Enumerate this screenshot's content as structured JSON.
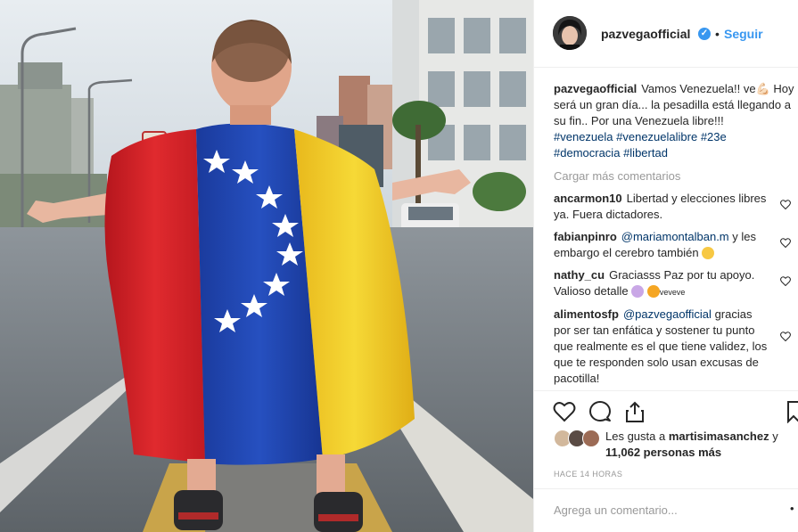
{
  "post": {
    "username": "pazvegaofficial",
    "follow_label": "Seguir",
    "header_separator": "•",
    "caption": {
      "username": "pazvegaofficial",
      "text": "Vamos Venezuela!! ve💪🏻 Hoy será un gran día... la pesadilla está llegando a su fin.. Por una Venezuela libre!!!",
      "hashtags": [
        "#venezuela",
        "#venezuelalibre",
        "#23e",
        "#democracia",
        "#libertad"
      ]
    },
    "load_more": "Cargar más comentarios",
    "comments": [
      {
        "username": "ancarmon10",
        "text": "Libertad y elecciones libres ya. Fuera dictadores."
      },
      {
        "username": "fabianpinro",
        "mention": "@mariamontalban.m",
        "text": "y les embargo el cerebro también"
      },
      {
        "username": "nathy_cu",
        "text": "Graciasss Paz por tu apoyo. Valioso detalle",
        "suffix": "veveve"
      },
      {
        "username": "alimentosfp",
        "mention": "@pazvegaofficial",
        "text": "gracias por ser tan enfática y sostener tu punto que realmente es el que tiene validez, los que te responden solo usan excusas de pacotilla!"
      }
    ],
    "likes": {
      "prefix": "Les gusta a",
      "user": "martisimasanchez",
      "joiner": "y",
      "count": "11,062 personas más"
    },
    "time": "HACE 14 HORAS",
    "add_comment_placeholder": "Agrega un comentario...",
    "icons": [
      "heart-icon",
      "comment-icon",
      "share-icon",
      "bookmark-icon",
      "verified-badge-icon"
    ],
    "colors": {
      "link": "#3897f0",
      "hashtag": "#003569",
      "muted": "#999999",
      "flag_yellow": "#f4d12e",
      "flag_blue": "#1d3fa8",
      "flag_red": "#d8232a"
    }
  }
}
